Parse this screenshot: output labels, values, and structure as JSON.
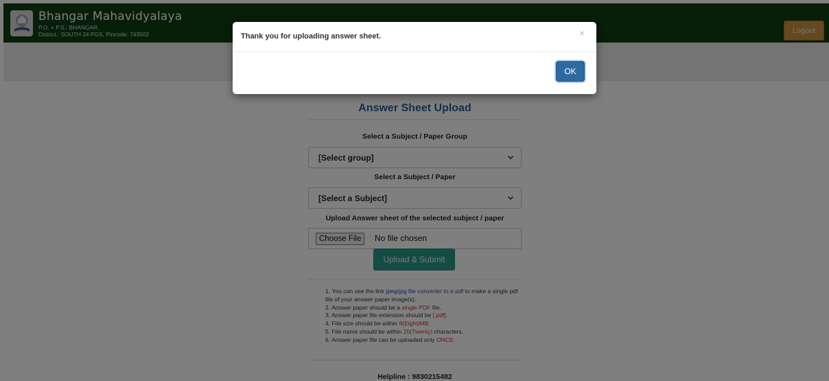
{
  "header": {
    "site_name": "Bhangar Mahavidyalaya",
    "address_line1": "P.O. + P.S.: BHANGAR,",
    "address_line2": "District.: SOUTH 24 PGS, Pincode: 743502",
    "logout_label": "Logout"
  },
  "form": {
    "title": "Answer Sheet Upload",
    "group_label": "Select a Subject / Paper Group",
    "group_select": "[Select group]",
    "subject_label": "Select a Subject / Paper",
    "subject_select": "[Select a Subject]",
    "upload_label": "Upload Answer sheet of the selected subject / paper",
    "file_button": "Choose File",
    "file_status": "No file chosen",
    "submit_label": "Upload & Submit"
  },
  "notes": {
    "n1_prefix": "1. You can use the link",
    "n1_link": "jpeg/jpg file converter to a pdf",
    "n1_suffix": "to make a single pdf file of your answer paper image(s).",
    "n2_prefix": "2. Answer paper should be a",
    "n2_highlight": "single PDF",
    "n2_suffix": "file.",
    "n3_prefix": "3. Answer paper file extension should be",
    "n3_highlight": "[.pdf].",
    "n4_prefix": "4. File size should be within",
    "n4_highlight": "8(Eight)MB.",
    "n5_prefix": "5. File name should be within",
    "n5_highlight": "20(Twenty)",
    "n5_suffix": "characters.",
    "n6_prefix": "6. Answer paper file can be uploaded only",
    "n6_highlight": "ONCE."
  },
  "helpline": "Helpline : 9830215482",
  "modal": {
    "message": "Thank you for uploading answer sheet.",
    "close_symbol": "×",
    "ok_label": "OK"
  },
  "colors": {
    "header_bg": "#0f3d11",
    "logout_bg": "#c9903e",
    "submit_bg": "#2a9b8a",
    "title_blue": "#2b5d8f",
    "ok_bg": "#2e6aa1",
    "highlight_red": "#c8302b",
    "link_blue": "#2e43b4"
  },
  "icons": {
    "logo": "college-emblem-icon",
    "select_arrow": "chevron-down-icon",
    "close": "close-icon"
  }
}
